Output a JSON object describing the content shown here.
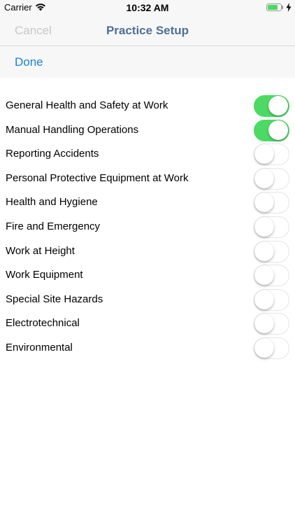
{
  "status_bar": {
    "carrier": "Carrier",
    "time": "10:32 AM",
    "battery_level": 0.8
  },
  "nav": {
    "cancel_label": "Cancel",
    "title": "Practice Setup"
  },
  "toolbar": {
    "done_label": "Done"
  },
  "colors": {
    "switch_on": "#4cd964",
    "title": "#4d7096",
    "link": "#1a82d9",
    "disabled": "#c7c7cc"
  },
  "topics": [
    {
      "label": "General Health and Safety at Work",
      "enabled": true
    },
    {
      "label": "Manual Handling Operations",
      "enabled": true
    },
    {
      "label": "Reporting Accidents",
      "enabled": false
    },
    {
      "label": "Personal Protective Equipment at Work",
      "enabled": false
    },
    {
      "label": "Health and Hygiene",
      "enabled": false
    },
    {
      "label": "Fire and Emergency",
      "enabled": false
    },
    {
      "label": "Work at Height",
      "enabled": false
    },
    {
      "label": "Work Equipment",
      "enabled": false
    },
    {
      "label": "Special Site Hazards",
      "enabled": false
    },
    {
      "label": "Electrotechnical",
      "enabled": false
    },
    {
      "label": "Environmental",
      "enabled": false
    }
  ]
}
